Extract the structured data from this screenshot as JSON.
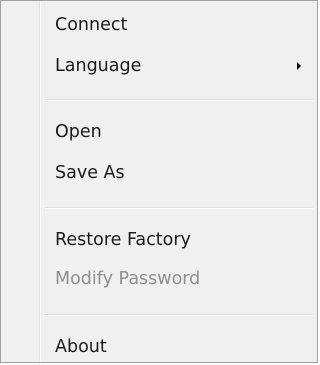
{
  "menu": {
    "items": [
      {
        "label": "Connect"
      },
      {
        "label": "Language",
        "submenu_icon": "submenu-arrow-icon"
      },
      {
        "label": "Open"
      },
      {
        "label": "Save As"
      },
      {
        "label": "Restore Factory"
      },
      {
        "label": "Modify Password",
        "state": "disabled"
      },
      {
        "label": "About"
      }
    ]
  },
  "colors": {
    "background": "#f0f0f0",
    "text": "#1a1a1a",
    "disabled_text": "#8f8f8f",
    "separator": "#e0e0e0"
  }
}
